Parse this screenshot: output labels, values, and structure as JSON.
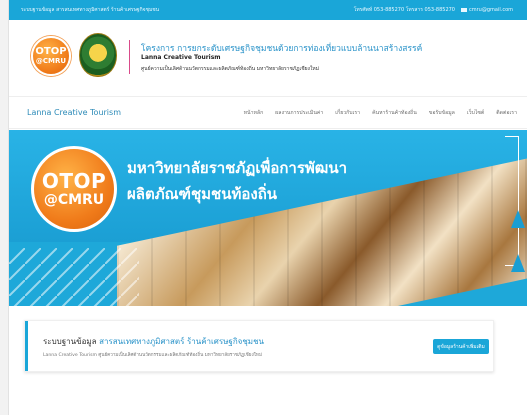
{
  "topbar": {
    "left_text": "ระบบฐานข้อมูล สารสนเทศทางภูมิศาสตร์ ร้านค้าเศรษฐกิจชุมชน",
    "phone_text": "โทรศัพท์ 053-885270 โทรสาร 053-885270",
    "email_text": "cmru@gmail.com"
  },
  "header": {
    "otop_logo_line1": "OTOP",
    "otop_logo_line2": "@CMRU",
    "project_title": "โครงการ การยกระดับเศรษฐกิจชุมชนด้วยการท่องเที่ยวแบบล้านนาสร้างสรรค์",
    "project_subtitle_en": "Lanna Creative Tourism",
    "project_subtitle_th": "ศูนย์ความเป็นเลิศด้านนวัตกรรมและผลิตภัณฑ์ท้องถิ่น มหาวิทยาลัยราชภัฏเชียงใหม่"
  },
  "nav": {
    "brand": "Lanna Creative Tourism",
    "links": [
      "หน้าหลัก",
      "ผลงานการประเมินค่า",
      "เกี่ยวกับเรา",
      "ค้นหาร้านค้าท้องถิ่น",
      "ขอรับข้อมูล",
      "เว็บไซต์",
      "ติดต่อเรา"
    ]
  },
  "hero": {
    "otop_line1": "OTOP",
    "otop_line2": "@CMRU",
    "line1": "มหาวิทยาลัยราชภัฏเพื่อการพัฒนา",
    "line2": "ผลิตภัณฑ์ชุมชนท้องถิ่น"
  },
  "info": {
    "title_prefix": "ระบบฐานข้อมูล",
    "title_highlight": "สารสนเทศทางภูมิศาสตร์ ร้านค้าเศรษฐกิจชุมชน",
    "description": "Lanna Creative Tourism ศูนย์ความเป็นเลิศด้านนวัตกรรมและผลิตภัณฑ์ท้องถิ่น มหาวิทยาลัยราชภัฏเชียงใหม่",
    "button_label": "ดูข้อมูลร้านค้าเพิ่มเติม"
  },
  "colors": {
    "accent": "#1aa6d8",
    "otop_orange": "#f07b1a",
    "title_blue": "#2a93c9"
  }
}
